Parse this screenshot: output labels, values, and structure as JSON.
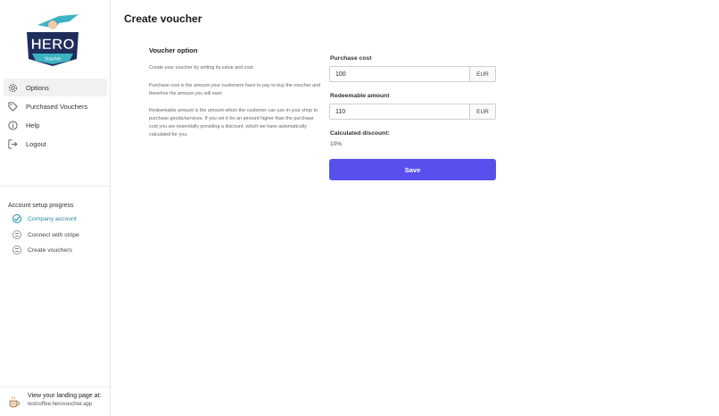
{
  "brand": {
    "logo_text": "HERO",
    "logo_subtext": "Voucher",
    "accent_color": "#5850ec",
    "success_color": "#1e8fa3"
  },
  "sidebar": {
    "nav": [
      {
        "label": "Options",
        "icon": "gear-icon",
        "active": true
      },
      {
        "label": "Purchased Vouchers",
        "icon": "tag-icon",
        "active": false
      },
      {
        "label": "Help",
        "icon": "info-icon",
        "active": false
      },
      {
        "label": "Logout",
        "icon": "logout-icon",
        "active": false
      }
    ],
    "progress": {
      "title": "Account setup progress",
      "steps": [
        {
          "label": "Company account",
          "done": true
        },
        {
          "label": "Connect with stripe",
          "done": false
        },
        {
          "label": "Create vouchers",
          "done": false
        }
      ]
    },
    "footer": {
      "title": "View your landing page at:",
      "url": "testcoffee.herovoucher.app"
    }
  },
  "main": {
    "title": "Create voucher",
    "section_title": "Voucher option",
    "descriptions": [
      "Create your voucher by setting its value and cost.",
      "Purchase cost is the amount your customers have to pay to buy the voucher and therefore the amount you will earn.",
      "Redeemable amount is the amount which the customer can use in your shop to purchase goods/services. If you set it for an amount higher than the purchase cost you are essentially providing a discount, which we have automatically calculated for you."
    ],
    "purchase_cost": {
      "label": "Purchase cost",
      "value": "100",
      "currency": "EUR"
    },
    "redeemable_amount": {
      "label": "Redeemable amount",
      "value": "110",
      "currency": "EUR"
    },
    "calculated_discount": {
      "label": "Calculated discount:",
      "value": "10%"
    },
    "save_label": "Save"
  }
}
